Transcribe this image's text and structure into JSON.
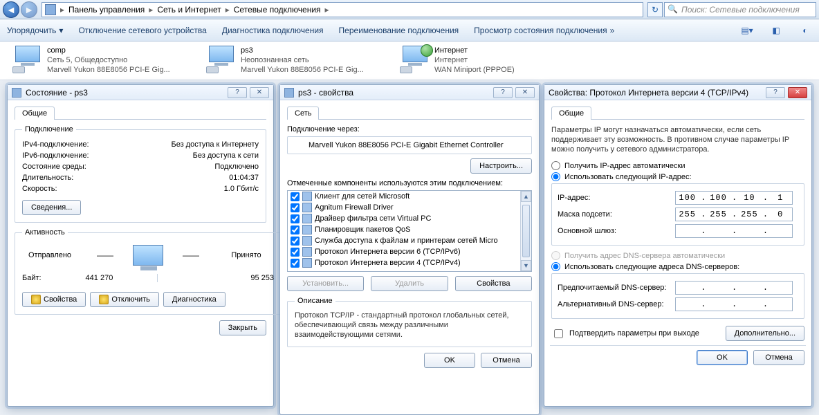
{
  "breadcrumb": {
    "p1": "Панель управления",
    "p2": "Сеть и Интернет",
    "p3": "Сетевые подключения"
  },
  "search": {
    "placeholder": "Поиск: Сетевые подключения"
  },
  "toolbar": {
    "organize": "Упорядочить",
    "disable": "Отключение сетевого устройства",
    "diag": "Диагностика подключения",
    "rename": "Переименование подключения",
    "status": "Просмотр состояния подключения"
  },
  "connections": [
    {
      "name": "comp",
      "line2": "Сеть 5, Общедоступно",
      "line3": "Marvell Yukon 88E8056 PCI-E Gig...",
      "globe": false
    },
    {
      "name": "ps3",
      "line2": "Неопознанная сеть",
      "line3": "Marvell Yukon 88E8056 PCI-E Gig...",
      "globe": false
    },
    {
      "name": "Интернет",
      "line2": "Интернет",
      "line3": "WAN Miniport (PPPOE)",
      "globe": true
    }
  ],
  "win1": {
    "title": "Состояние - ps3",
    "tab": "Общие",
    "group_conn": "Подключение",
    "ipv4_l": "IPv4-подключение:",
    "ipv4_v": "Без доступа к Интернету",
    "ipv6_l": "IPv6-подключение:",
    "ipv6_v": "Без доступа к сети",
    "media_l": "Состояние среды:",
    "media_v": "Подключено",
    "dur_l": "Длительность:",
    "dur_v": "01:04:37",
    "spd_l": "Скорость:",
    "spd_v": "1.0 Гбит/с",
    "details": "Сведения...",
    "group_act": "Активность",
    "sent": "Отправлено",
    "recv": "Принято",
    "bytes_l": "Байт:",
    "sent_v": "441 270",
    "recv_v": "95 253",
    "b_props": "Свойства",
    "b_disable": "Отключить",
    "b_diag": "Диагностика",
    "close": "Закрыть"
  },
  "win2": {
    "title": "ps3 - свойства",
    "tab": "Сеть",
    "conn_via": "Подключение через:",
    "adapter": "Marvell Yukon 88E8056 PCI-E Gigabit Ethernet Controller",
    "configure": "Настроить...",
    "components_l": "Отмеченные компоненты используются этим подключением:",
    "items": [
      "Клиент для сетей Microsoft",
      "Agnitum Firewall Driver",
      "Драйвер фильтра сети Virtual PC",
      "Планировщик пакетов QoS",
      "Служба доступа к файлам и принтерам сетей Micro",
      "Протокол Интернета версии 6 (TCP/IPv6)",
      "Протокол Интернета версии 4 (TCP/IPv4)"
    ],
    "install": "Установить...",
    "remove": "Удалить",
    "props": "Свойства",
    "desc_g": "Описание",
    "desc": "Протокол TCP/IP - стандартный протокол глобальных сетей, обеспечивающий связь между различными взаимодействующими сетями.",
    "ok": "OK",
    "cancel": "Отмена"
  },
  "win3": {
    "title": "Свойства: Протокол Интернета версии 4 (TCP/IPv4)",
    "tab": "Общие",
    "blurb": "Параметры IP могут назначаться автоматически, если сеть поддерживает эту возможность. В противном случае параметры IP можно получить у сетевого администратора.",
    "r_auto_ip": "Получить IP-адрес автоматически",
    "r_man_ip": "Использовать следующий IP-адрес:",
    "ip_l": "IP-адрес:",
    "ip_v": [
      "100",
      "100",
      "10",
      "1"
    ],
    "mask_l": "Маска подсети:",
    "mask_v": [
      "255",
      "255",
      "255",
      "0"
    ],
    "gw_l": "Основной шлюз:",
    "gw_v": [
      "",
      "",
      "",
      ""
    ],
    "r_auto_dns": "Получить адрес DNS-сервера автоматически",
    "r_man_dns": "Использовать следующие адреса DNS-серверов:",
    "dns1_l": "Предпочитаемый DNS-сервер:",
    "dns1_v": [
      "",
      "",
      "",
      ""
    ],
    "dns2_l": "Альтернативный DNS-сервер:",
    "dns2_v": [
      "",
      "",
      "",
      ""
    ],
    "confirm": "Подтвердить параметры при выходе",
    "adv": "Дополнительно...",
    "ok": "OK",
    "cancel": "Отмена"
  }
}
